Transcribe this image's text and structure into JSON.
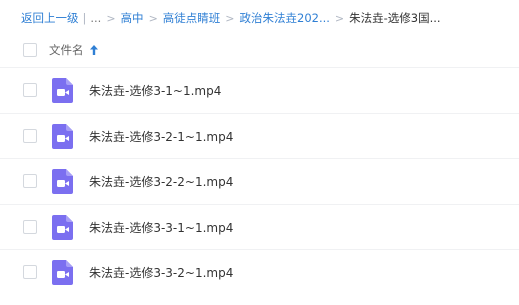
{
  "breadcrumb": {
    "back_label": "返回上一级",
    "pipe": "|",
    "ellipsis": "...",
    "sep": ">",
    "items": [
      "高中",
      "高徒点睛班",
      "政治朱法垚202..."
    ],
    "current": "朱法垚-选修3国..."
  },
  "list_header": {
    "column_name": "文件名",
    "sort": "ascending"
  },
  "files": [
    {
      "name": "朱法垚-选修3-1~1.mp4",
      "icon": "video-file-icon"
    },
    {
      "name": "朱法垚-选修3-2-1~1.mp4",
      "icon": "video-file-icon"
    },
    {
      "name": "朱法垚-选修3-2-2~1.mp4",
      "icon": "video-file-icon"
    },
    {
      "name": "朱法垚-选修3-3-1~1.mp4",
      "icon": "video-file-icon"
    },
    {
      "name": "朱法垚-选修3-3-2~1.mp4",
      "icon": "video-file-icon"
    }
  ],
  "colors": {
    "link": "#2f7fd4",
    "video_icon": "#7b6ff0"
  }
}
